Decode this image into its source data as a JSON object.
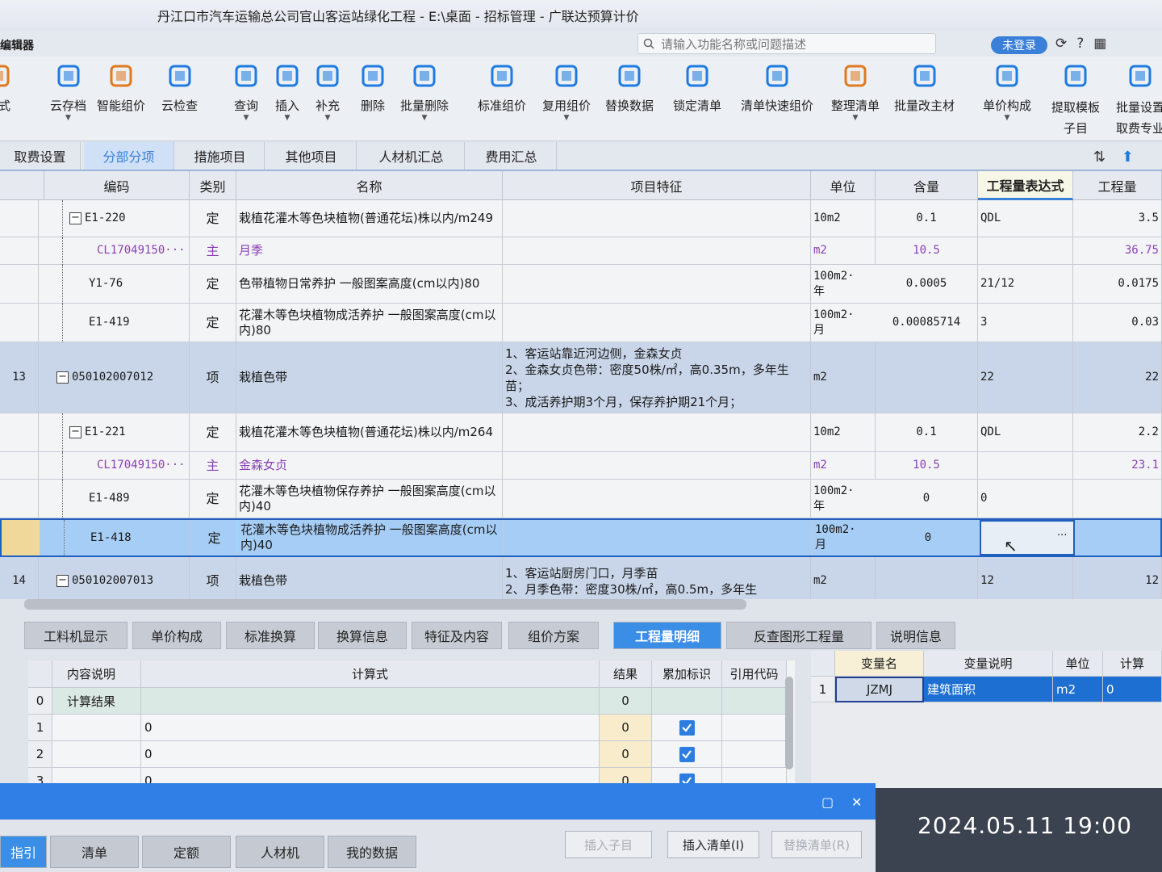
{
  "window": {
    "title": "丹江口市汽车运输总公司官山客运站绿化工程 - E:\\桌面 - 招标管理 - 广联达预算计价",
    "app_name": "编辑器"
  },
  "search": {
    "placeholder": "请输入功能名称或问题描述"
  },
  "login_label": "未登录",
  "ribbon": [
    {
      "label": "形式",
      "icon": "format-icon",
      "color": "#e07a1e"
    },
    {
      "label": "云存档",
      "icon": "cloud-upload-icon",
      "color": "#1e7be0"
    },
    {
      "label": "智能组价",
      "icon": "smart-price-icon",
      "color": "#e07a1e"
    },
    {
      "label": "云检查",
      "icon": "cloud-check-icon",
      "color": "#1e7be0"
    },
    {
      "label": "查询",
      "icon": "query-icon",
      "color": "#1e7be0"
    },
    {
      "label": "插入",
      "icon": "insert-icon",
      "color": "#1e7be0"
    },
    {
      "label": "补充",
      "icon": "supplement-icon",
      "color": "#1e7be0"
    },
    {
      "label": "删除",
      "icon": "delete-icon",
      "color": "#1e7be0"
    },
    {
      "label": "批量删除",
      "icon": "batch-delete-icon",
      "color": "#1e7be0"
    },
    {
      "label": "标准组价",
      "icon": "standard-price-icon",
      "color": "#1e7be0"
    },
    {
      "label": "复用组价",
      "icon": "reuse-price-icon",
      "color": "#1e7be0"
    },
    {
      "label": "替换数据",
      "icon": "replace-data-icon",
      "color": "#1e7be0"
    },
    {
      "label": "锁定清单",
      "icon": "lock-icon",
      "color": "#1e7be0"
    },
    {
      "label": "清单快速组价",
      "icon": "quick-price-icon",
      "color": "#1e7be0"
    },
    {
      "label": "整理清单",
      "icon": "organize-list-icon",
      "color": "#e07a1e"
    },
    {
      "label": "批量改主材",
      "icon": "batch-material-icon",
      "color": "#1e7be0"
    },
    {
      "label": "单价构成",
      "icon": "unit-price-icon",
      "color": "#1e7be0"
    },
    {
      "label": "提取模板子目",
      "icon": "template-icon",
      "color": "#1e7be0"
    },
    {
      "label": "批量设置取费专业",
      "icon": "fee-icon",
      "color": "#1e7be0"
    }
  ],
  "main_tabs": [
    "取费设置",
    "分部分项",
    "措施项目",
    "其他项目",
    "人材机汇总",
    "费用汇总"
  ],
  "grid": {
    "headers": [
      "编码",
      "类别",
      "名称",
      "项目特征",
      "单位",
      "含量",
      "工程量表达式",
      "工程量"
    ],
    "rows": [
      {
        "type": "sub",
        "no": "",
        "code": "E1-220",
        "kind": "定",
        "name": "栽植花灌木等色块植物(普通花坛)株以内/m249",
        "feature": "",
        "unit": "10m2",
        "qty": "0.1",
        "expr": "QDL",
        "amount": "3.5",
        "purple": false,
        "exp": true
      },
      {
        "type": "mat",
        "no": "",
        "code": "CL17049150···",
        "kind": "主",
        "name": "月季",
        "feature": "",
        "unit": "m2",
        "qty": "10.5",
        "expr": "",
        "amount": "36.75",
        "purple": true,
        "exp": false
      },
      {
        "type": "sub",
        "no": "",
        "code": "Y1-76",
        "kind": "定",
        "name": "色带植物日常养护 一般图案高度(cm以内)80",
        "feature": "",
        "unit": "100m2·年",
        "qty": "0.0005",
        "expr": "21/12",
        "amount": "0.0175",
        "purple": false,
        "exp": false
      },
      {
        "type": "sub",
        "no": "",
        "code": "E1-419",
        "kind": "定",
        "name": "花灌木等色块植物成活养护 一般图案高度(cm以内)80",
        "feature": "",
        "unit": "100m2·月",
        "qty": "0.00085714",
        "expr": "3",
        "amount": "0.03",
        "purple": false,
        "exp": false
      },
      {
        "type": "item",
        "no": "13",
        "code": "050102007012",
        "kind": "项",
        "name": "栽植色带",
        "feature": "1、客运站靠近河边侧，金森女贞\n2、金森女贞色带：密度50株/㎡，高0.35m，多年生苗；\n3、成活养护期3个月，保存养护期21个月；",
        "unit": "m2",
        "qty": "",
        "expr": "22",
        "amount": "22",
        "purple": false,
        "exp": true
      },
      {
        "type": "sub",
        "no": "",
        "code": "E1-221",
        "kind": "定",
        "name": "栽植花灌木等色块植物(普通花坛)株以内/m264",
        "feature": "",
        "unit": "10m2",
        "qty": "0.1",
        "expr": "QDL",
        "amount": "2.2",
        "purple": false,
        "exp": true
      },
      {
        "type": "mat",
        "no": "",
        "code": "CL17049150···",
        "kind": "主",
        "name": "金森女贞",
        "feature": "",
        "unit": "m2",
        "qty": "10.5",
        "expr": "",
        "amount": "23.1",
        "purple": true,
        "exp": false
      },
      {
        "type": "sub",
        "no": "",
        "code": "E1-489",
        "kind": "定",
        "name": "花灌木等色块植物保存养护 一般图案高度(cm以内)40",
        "feature": "",
        "unit": "100m2·年",
        "qty": "0",
        "expr": "0",
        "amount": "",
        "purple": false,
        "exp": false
      },
      {
        "type": "sel",
        "no": "",
        "code": "E1-418",
        "kind": "定",
        "name": "花灌木等色块植物成活养护 一般图案高度(cm以内)40",
        "feature": "",
        "unit": "100m2·月",
        "qty": "0",
        "expr": "",
        "amount": "",
        "purple": false,
        "exp": false
      },
      {
        "type": "item",
        "no": "14",
        "code": "050102007013",
        "kind": "项",
        "name": "栽植色带",
        "feature": "1、客运站厨房门口，月季苗\n2、月季色带：密度30株/㎡，高0.5m，多年生",
        "unit": "m2",
        "qty": "",
        "expr": "12",
        "amount": "12",
        "purple": false,
        "exp": true
      }
    ]
  },
  "bottom_tabs": [
    "工料机显示",
    "单价构成",
    "标准换算",
    "换算信息",
    "特征及内容",
    "组价方案",
    "工程量明细",
    "反查图形工程量",
    "说明信息"
  ],
  "detail": {
    "headers": [
      "内容说明",
      "计算式",
      "结果",
      "累加标识",
      "引用代码"
    ],
    "rows": [
      {
        "no": "0",
        "desc": "计算结果",
        "formula": "",
        "result": "0",
        "checked": false
      },
      {
        "no": "1",
        "desc": "",
        "formula": "0",
        "result": "0",
        "checked": true
      },
      {
        "no": "2",
        "desc": "",
        "formula": "0",
        "result": "0",
        "checked": true
      },
      {
        "no": "3",
        "desc": "",
        "formula": "0",
        "result": "0",
        "checked": true
      }
    ]
  },
  "vars": {
    "headers": [
      "变量名",
      "变量说明",
      "单位",
      "计算"
    ],
    "rows": [
      {
        "no": "1",
        "name": "JZMJ",
        "desc": "建筑面积",
        "unit": "m2",
        "value": "0"
      }
    ]
  },
  "lower_tabs": [
    "指引",
    "清单",
    "定额",
    "人材机",
    "我的数据"
  ],
  "lower_buttons": [
    "插入子目",
    "插入清单(I)",
    "替换清单(R)"
  ],
  "timestamp": "2024.05.11  19:00"
}
